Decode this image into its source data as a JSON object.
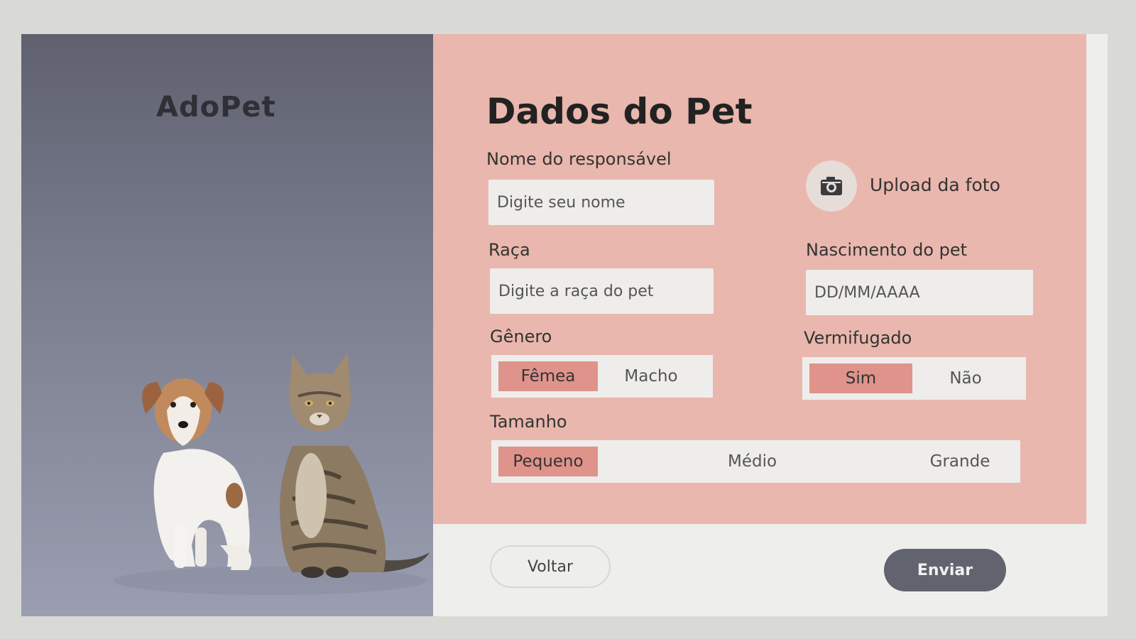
{
  "brand": {
    "name": "AdoPet"
  },
  "form": {
    "title": "Dados do Pet",
    "owner_name": {
      "label": "Nome do responsável",
      "placeholder": "Digite seu nome"
    },
    "upload": {
      "label": "Upload da foto"
    },
    "breed": {
      "label": "Raça",
      "placeholder": "Digite a raça do pet"
    },
    "birth": {
      "label": "Nascimento do pet",
      "placeholder": "DD/MM/AAAA"
    },
    "gender": {
      "label": "Gênero",
      "options": [
        "Fêmea",
        "Macho"
      ],
      "selected": "Fêmea"
    },
    "dewormed": {
      "label": "Vermifugado",
      "options": [
        "Sim",
        "Não"
      ],
      "selected": "Sim"
    },
    "size": {
      "label": "Tamanho",
      "options": [
        "Pequeno",
        "Médio",
        "Grande"
      ],
      "selected": "Pequeno"
    }
  },
  "actions": {
    "back_label": "Voltar",
    "send_label": "Enviar"
  },
  "icons": {
    "upload": "camera-icon"
  },
  "colors": {
    "left_panel": "#6f7282",
    "form_card": "#e9b7ad",
    "input_bg": "#eeedeb",
    "selected_option": "#df938b",
    "send_button": "#61636f"
  }
}
